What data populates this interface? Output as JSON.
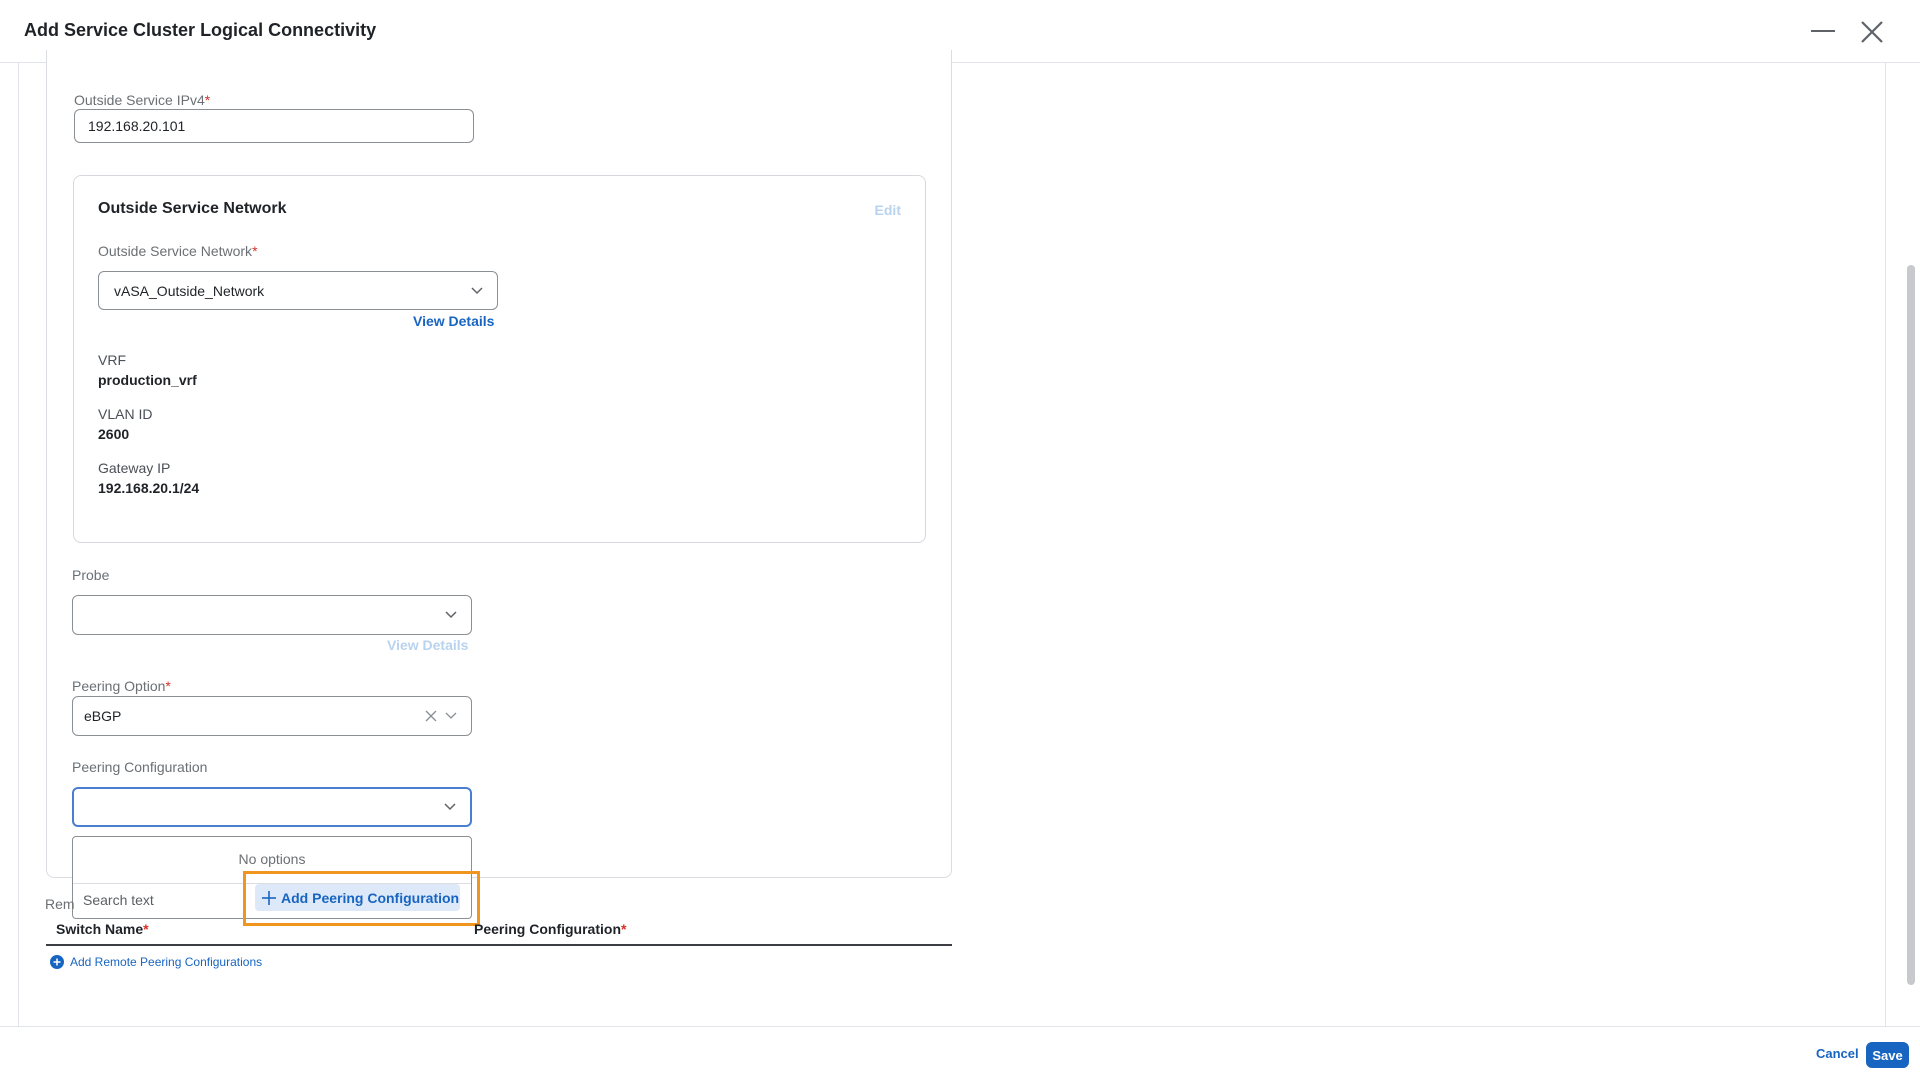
{
  "window": {
    "title": "Add Service Cluster Logical Connectivity"
  },
  "form": {
    "outside_service_ipv4": {
      "label": "Outside Service IPv4",
      "required": "*",
      "value": "192.168.20.101"
    },
    "outside_service_network_card": {
      "title": "Outside Service Network",
      "edit_label": "Edit",
      "field_label": "Outside Service Network",
      "required": "*",
      "selected": "vASA_Outside_Network",
      "view_details": "View Details",
      "vrf_label": "VRF",
      "vrf_value": "production_vrf",
      "vlan_label": "VLAN ID",
      "vlan_value": "2600",
      "gateway_label": "Gateway IP",
      "gateway_value": "192.168.20.1/24"
    },
    "probe": {
      "label": "Probe",
      "selected": "",
      "view_details": "View Details"
    },
    "peering_option": {
      "label": "Peering Option",
      "required": "*",
      "selected": "eBGP"
    },
    "peering_configuration": {
      "label": "Peering Configuration",
      "selected": "",
      "dropdown": {
        "no_options": "No options",
        "search_placeholder": "Search text",
        "add_button": "Add Peering Configuration"
      }
    },
    "remote_peering": {
      "section_label_partial": "Rem",
      "columns": [
        {
          "label": "Switch Name",
          "required": "*"
        },
        {
          "label": "Peering Configuration",
          "required": "*"
        }
      ],
      "add_link": "Add Remote Peering Configurations"
    }
  },
  "footer": {
    "cancel_label": "Cancel",
    "save_label": "Save"
  },
  "colors": {
    "accent": "#1865c1",
    "required": "#d93025",
    "highlight": "#f0961e"
  }
}
